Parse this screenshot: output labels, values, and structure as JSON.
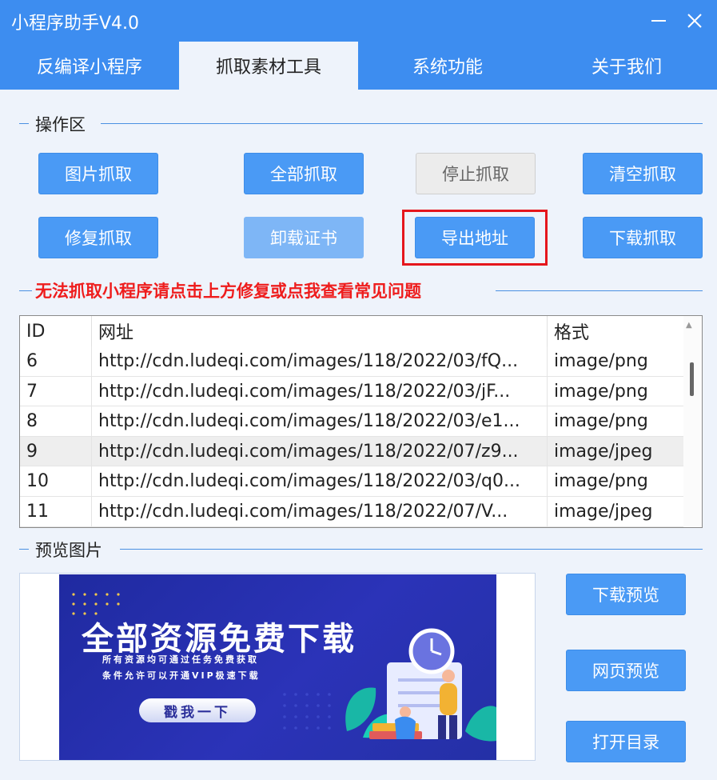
{
  "window": {
    "title": "小程序助手V4.0"
  },
  "tabs": [
    {
      "label": "反编译小程序"
    },
    {
      "label": "抓取素材工具"
    },
    {
      "label": "系统功能"
    },
    {
      "label": "关于我们"
    }
  ],
  "ops": {
    "group_label": "操作区",
    "buttons": [
      {
        "label": "图片抓取"
      },
      {
        "label": "全部抓取"
      },
      {
        "label": "停止抓取"
      },
      {
        "label": "清空抓取"
      },
      {
        "label": "修复抓取"
      },
      {
        "label": "卸载证书"
      },
      {
        "label": "导出地址"
      },
      {
        "label": "下载抓取"
      }
    ]
  },
  "warning": "无法抓取小程序请点击上方修复或点我查看常见问题",
  "table": {
    "headers": {
      "id": "ID",
      "url": "网址",
      "format": "格式"
    },
    "rows": [
      {
        "id": "6",
        "url": "http://cdn.ludeqi.com/images/118/2022/03/fQ...",
        "format": "image/png"
      },
      {
        "id": "7",
        "url": "http://cdn.ludeqi.com/images/118/2022/03/jF...",
        "format": "image/png"
      },
      {
        "id": "8",
        "url": "http://cdn.ludeqi.com/images/118/2022/03/e1...",
        "format": "image/png"
      },
      {
        "id": "9",
        "url": "http://cdn.ludeqi.com/images/118/2022/07/z9...",
        "format": "image/jpeg"
      },
      {
        "id": "10",
        "url": "http://cdn.ludeqi.com/images/118/2022/03/q0...",
        "format": "image/png"
      },
      {
        "id": "11",
        "url": "http://cdn.ludeqi.com/images/118/2022/07/V...",
        "format": "image/jpeg"
      }
    ]
  },
  "preview": {
    "group_label": "预览图片",
    "banner": {
      "title": "全部资源免费下载",
      "line1": "所有资源均可通过任务免费获取",
      "line2": "条件允许可以开通VIP极速下载",
      "button": "戳我一下"
    },
    "buttons": [
      {
        "label": "下载预览"
      },
      {
        "label": "网页预览"
      },
      {
        "label": "打开目录"
      }
    ]
  },
  "colors": {
    "accent": "#3d8df0",
    "button": "#4a9af5",
    "warning": "#ee1d1d"
  }
}
